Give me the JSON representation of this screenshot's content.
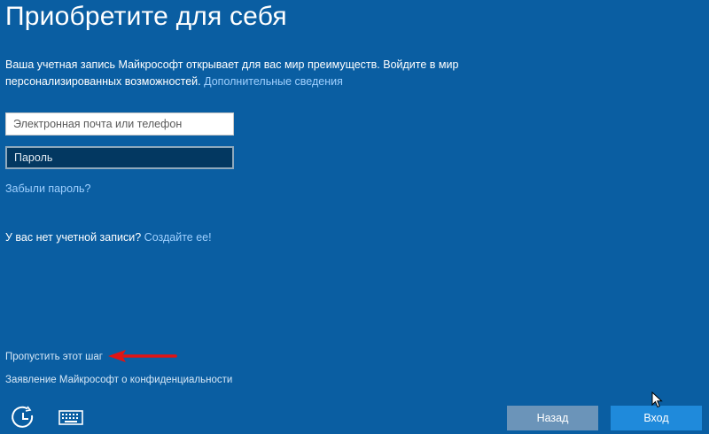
{
  "page": {
    "title": "Приобретите для себя",
    "description": "Ваша учетная запись Майкрософт открывает для вас мир преимуществ. Войдите в мир персонализированных возможностей.",
    "more_info_link": "Дополнительные сведения"
  },
  "form": {
    "email_placeholder": "Электронная почта или телефон",
    "password_placeholder": "Пароль",
    "forgot_password": "Забыли пароль?"
  },
  "account": {
    "no_account_text": "У вас нет учетной записи?",
    "create_link": "Создайте ее!"
  },
  "footer": {
    "skip_step": "Пропустить этот шаг",
    "privacy_statement": "Заявление Майкрософт о конфиденциальности"
  },
  "buttons": {
    "back": "Назад",
    "login": "Вход"
  },
  "icons": {
    "ease_of_access": "ease-of-access-icon",
    "keyboard": "keyboard-icon",
    "annotation_arrow": "red-arrow-icon",
    "cursor": "mouse-cursor-icon"
  },
  "colors": {
    "background": "#0a5ea2",
    "link": "#9fd0ff",
    "password_field": "#033861",
    "back_button": "#6b94b9",
    "login_button": "#1f8adb",
    "annotation_arrow": "#e01414"
  }
}
